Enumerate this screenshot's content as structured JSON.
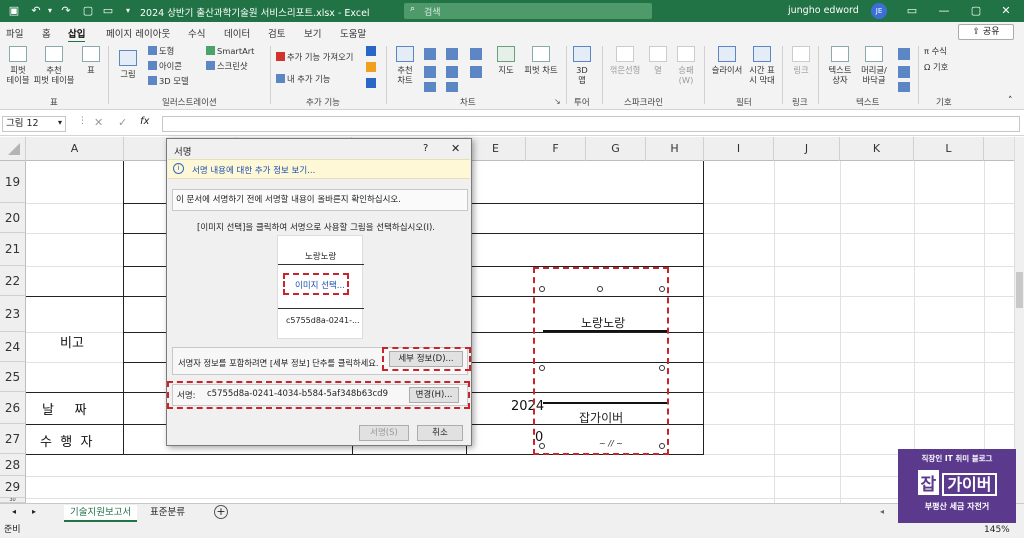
{
  "titlebar": {
    "file_title": "2024 상반기 출산과학기술원 서비스리포트.xlsx  -  Excel",
    "search_placeholder": "검색",
    "user_name": "jungho edword",
    "user_initials": "JE"
  },
  "tabs": [
    "파일",
    "홈",
    "삽입",
    "페이지 레이아웃",
    "수식",
    "데이터",
    "검토",
    "보기",
    "도움말"
  ],
  "share_label": "공유",
  "ribbon": {
    "pivot": "피벗\n테이블",
    "rec_pivot": "추천\n피벗 테이블",
    "table": "표",
    "group_table": "표",
    "picture": "그림",
    "shapes": "도형",
    "icons": "아이콘",
    "model3d": "3D 모델",
    "smartart": "SmartArt",
    "screenshot": "스크린샷",
    "group_illust": "일러스트레이션",
    "get_addin": "추가 기능 가져오기",
    "my_addin": "내 추가 기능",
    "group_addin": "추가 기능",
    "rec_chart": "추천\n차트",
    "maps": "지도",
    "pivot_chart": "피벗 차트",
    "group_chart": "차트",
    "map3d": "3D\n맵",
    "group_tour": "투어",
    "spark_line": "꺾은선형",
    "spark_col": "열",
    "spark_wl": "승패\n(W)",
    "group_spark": "스파크라인",
    "slicer": "슬라이서",
    "timeline": "시간 표\n시 막대",
    "group_filter": "필터",
    "link": "링크",
    "group_link": "링크",
    "textbox": "텍스트\n상자",
    "header": "머리글/\n바닥글",
    "group_text": "텍스트",
    "equation": "수식",
    "symbol": "기호",
    "group_symbol": "기호"
  },
  "namebox": "그림 12",
  "columns": [
    "A",
    "B",
    "C",
    "D",
    "E",
    "F",
    "G",
    "H",
    "I",
    "J",
    "K",
    "L"
  ],
  "rows": [
    "19",
    "20",
    "21",
    "22",
    "23",
    "24",
    "25",
    "26",
    "27",
    "28",
    "29",
    "30"
  ],
  "cells": {
    "bigo": "비고",
    "date_label": "날     짜",
    "doer_label": "수  행  자",
    "year": "2024",
    "zero": "0"
  },
  "signature_image": {
    "top_name": "노랑노랑",
    "bottom_name": "잡가이버"
  },
  "dialog": {
    "title": "서명",
    "help": "?",
    "close": "✕",
    "info_link": "서명 내용에 대한 추가 정보 보기...",
    "notice": "이 문서에 서명하기 전에 서명할 내용이 올바른지 확인하십시오.",
    "instruction": "[이미지 선택]을 클릭하여 서명으로 사용할 그림을 선택하십시오(I).",
    "preview_name": "노랑노랑",
    "select_image": "이미지 선택...",
    "preview_id": "c5755d8a-0241-...",
    "details_text": "서명자 정보를 포함하려면 [세부 정보] 단추를 클릭하세요.",
    "details_btn": "세부 정보(D)...",
    "signer_label": "서명:",
    "signer_value": "c5755d8a-0241-4034-b584-5af348b63cd9",
    "change_btn": "변경(H)...",
    "sign_btn": "서명(S)",
    "cancel_btn": "취소"
  },
  "sheets": [
    "기술지원보고서",
    "표준분류"
  ],
  "status": {
    "ready": "준비",
    "zoom": "145%"
  },
  "watermark": {
    "top": "직장인 IT 취미 블로그",
    "logo_char": "잡",
    "logo_rest": "가이버",
    "bottom": "부평산 세금 자전거"
  }
}
